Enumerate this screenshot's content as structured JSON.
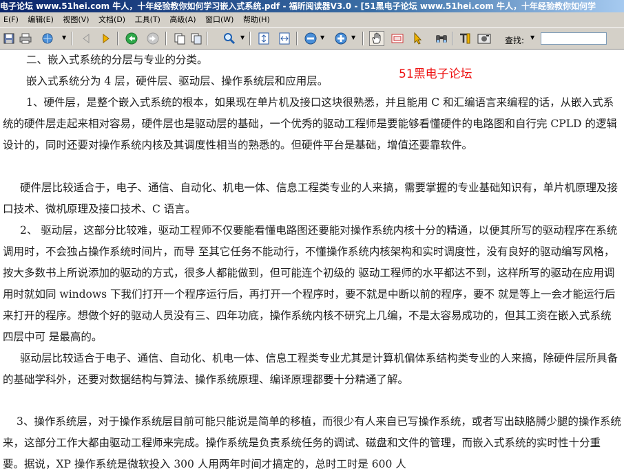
{
  "window": {
    "title": "电子论坛 www.51hei.com 牛人，十年经验教你如何学习嵌入式系统.pdf - 福昕阅读器V3.0 - [51黑电子论坛 www.51hei.com 牛人，十年经验教你如何学"
  },
  "menu": [
    "E(F)",
    "编辑(E)",
    "视图(V)",
    "文档(D)",
    "工具(T)",
    "高级(A)",
    "窗口(W)",
    "帮助(H)"
  ],
  "toolbar": {
    "icons": [
      "save-icon",
      "print-icon",
      "email-icon",
      "prev-page-icon",
      "next-page-icon",
      "back-icon",
      "forward-icon",
      "copy-page-icon",
      "paste-page-icon",
      "zoom-tool-icon",
      "fit-page-icon",
      "fit-width-icon",
      "zoom-out-icon",
      "zoom-in-icon",
      "hand-tool-icon",
      "snapshot-icon",
      "select-tool-icon",
      "find-icon",
      "text-select-icon",
      "image-select-icon"
    ],
    "search_label": "查找:",
    "search_value": ""
  },
  "document": {
    "watermark": "51黑电子论坛",
    "paragraphs": [
      "二、嵌入式系统的分层与专业的分类。",
      "嵌入式系统分为 4 层，硬件层、驱动层、操作系统层和应用层。",
      "1、硬件层，是整个嵌入式系统的根本，如果现在单片机及接口这块很熟悉，并且能用 C 和汇编语言来编程的话，从嵌入式系统的硬件层走起来相对容易，硬件层也是驱动层的基础，一个优秀的驱动工程师是要能够看懂硬件的电路图和自行完 CPLD 的逻辑设计的，同时还要对操作系统内核及其调度性相当的熟悉的。但硬件平台是基础，增值还要靠软件。",
      "硬件层比较适合于，电子、通信、自动化、机电一体、信息工程类专业的人来搞，需要掌握的专业基础知识有，单片机原理及接口技术、微机原理及接口技术、C 语言。",
      "2、 驱动层，这部分比较难，驱动工程师不仅要能看懂电路图还要能对操作系统内核十分的精通，以便其所写的驱动程序在系统调用时，不会独占操作系统时间片，而导 至其它任务不能动行，不懂操作系统内核架构和实时调度性，没有良好的驱动编写风格，按大多数书上所说添加的驱动的方式，很多人都能做到，但可能连个初级的 驱动工程师的水平都达不到，这样所写的驱动在应用调用时就如同 windows 下我们打开一个程序运行后，再打开一个程序时，要不就是中断以前的程序，要不 就是等上一会才能运行后来打开的程序。想做个好的驱动人员没有三、四年功底，操作系统内核不研究上几编，不是太容易成功的，但其工资在嵌入式系统四层中可 是最高的。",
      "驱动层比较适合于电子、通信、自动化、机电一体、信息工程类专业尤其是计算机偏体系结构类专业的人来搞，除硬件层所具备的基础学科外，还要对数据结构与算法、操作系统原理、编译原理都要十分精通了解。",
      "3、操作系统层，对于操作系统层目前可能只能说是简单的移植，而很少有人来自已写操作系统，或者写出缺胳膊少腿的操作系统来，这部分工作大都由驱动工程师来完成。操作系统是负责系统任务的调试、磁盘和文件的管理，而嵌入式系统的实时性十分重要。据说，XP 操作系统是微软投入 300 人用两年时间才搞定的，总时工时是 600 人"
    ]
  }
}
